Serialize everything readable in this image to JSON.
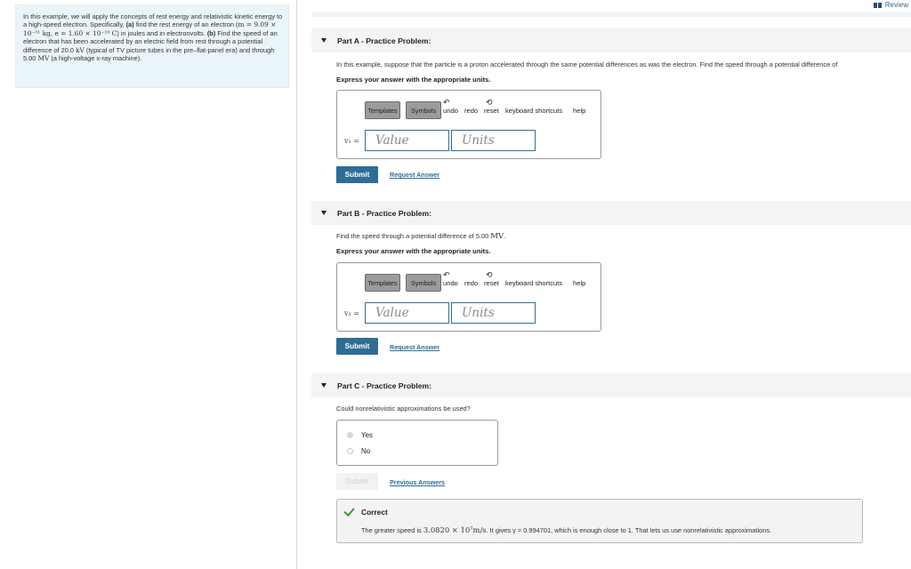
{
  "header": {
    "review_label": "Review"
  },
  "intro": {
    "t1": "In this example, we will apply the concepts of rest energy and relativistic kinetic energy to a high-speed electron. Specifically, ",
    "a": "(a)",
    "t2": " find the rest energy of an electron (",
    "mass_expr": "m = 9.09 × 10⁻³¹ kg, e = 1.60 × 10⁻¹⁹ C",
    "t3": ") in joules and in electronvolts. ",
    "b": "(b)",
    "t4": " Find the speed of an electron that has been accelerated by an electric field from rest through a potential difference of 20.0 ",
    "unit_kv": "kV",
    "t5": " (typical of TV picture tubes in the pre–flat-panel era) and through 5.00 ",
    "unit_mv": "MV",
    "t6": " (a high-voltage x-ray machine)."
  },
  "toolbar": {
    "templates": "Templates",
    "symbols": "Symbols",
    "undo": "undo",
    "redo": "redo",
    "reset": "reset",
    "shortcuts": "keyboard shortcuts",
    "help": "help"
  },
  "part_a": {
    "title": "Part A - Practice Problem:",
    "question": "In this example, suppose that the particle is a proton accelerated through the same potential differences as was the electron. Find the speed through a potential difference of",
    "express": "Express your answer with the appropriate units.",
    "var": "v₁ =",
    "value_placeholder": "Value",
    "units_placeholder": "Units",
    "submit": "Submit",
    "request": "Request Answer"
  },
  "part_b": {
    "title": "Part B - Practice Problem:",
    "question_pre": "Find the speed through a potential difference of 5.00 ",
    "question_unit": "MV",
    "question_post": ".",
    "express": "Express your answer with the appropriate units.",
    "var": "v₂ =",
    "value_placeholder": "Value",
    "units_placeholder": "Units",
    "submit": "Submit",
    "request": "Request Answer"
  },
  "part_c": {
    "title": "Part C - Practice Problem:",
    "question": "Could nonrelativistic approximations be used?",
    "options": [
      "Yes",
      "No"
    ],
    "selected": "Yes",
    "submit": "Submit",
    "previous": "Previous Answers",
    "feedback_title": "Correct",
    "feedback_pre": "The greater speed is ",
    "feedback_value": "3.0820 × 10⁷m/s",
    "feedback_post": ". It gives γ = 0.994701, which is enough close to 1. That lets us use nonrelativistic approximations."
  },
  "colors": {
    "accent": "#2e6d95",
    "intro_bg": "#eaf5f9",
    "correct": "#3c9c3c"
  }
}
